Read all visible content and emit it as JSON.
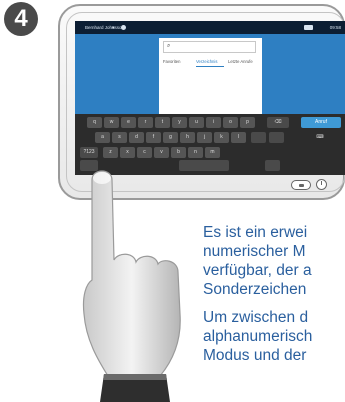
{
  "step_number": "4",
  "status_bar": {
    "user": "Bernhard Johnsson",
    "time": "09:58"
  },
  "panel": {
    "search_placeholder": "",
    "tabs": [
      "Favoriten",
      "Verzeichnis",
      "Letzte Anrufe"
    ],
    "active_tab_index": 1,
    "empty_text": "Kein Verzeichnis"
  },
  "keyboard": {
    "row1": [
      "q",
      "w",
      "e",
      "r",
      "t",
      "y",
      "u",
      "i",
      "o",
      "p"
    ],
    "row2": [
      "a",
      "s",
      "d",
      "f",
      "g",
      "h",
      "j",
      "k",
      "l"
    ],
    "row3": [
      "z",
      "x",
      "c",
      "v",
      "b",
      "n",
      "m"
    ],
    "call_label": "Anruf",
    "mode_label": "?123"
  },
  "description": {
    "lines": [
      "Es ist ein erwei",
      "numerischer M",
      "verfügbar, der a",
      "Sonderzeichen",
      "Um zwischen d",
      "alphanumerisch",
      "Modus und der"
    ]
  },
  "colors": {
    "accent": "#2e7fc2",
    "text": "#2a5f9e",
    "badge": "#4a4a4a"
  }
}
